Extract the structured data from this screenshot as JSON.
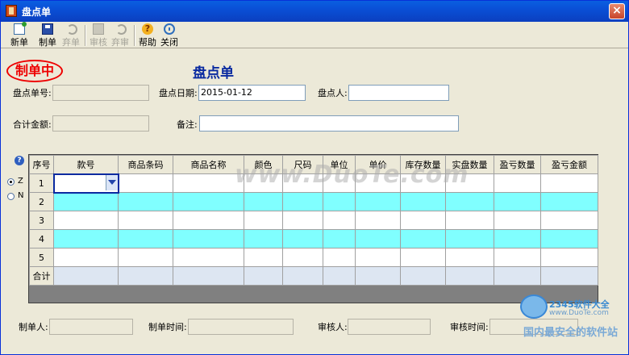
{
  "window": {
    "title": "盘点单",
    "close_symbol": "×"
  },
  "toolbar": {
    "buttons": [
      {
        "label": "新单",
        "icon": "new-document-icon",
        "enabled": true
      },
      {
        "label": "制单",
        "icon": "save-icon",
        "enabled": true
      },
      {
        "label": "弃单",
        "icon": "undo-icon",
        "enabled": false
      },
      {
        "label": "审核",
        "icon": "audit-icon",
        "enabled": false
      },
      {
        "label": "弃审",
        "icon": "undo-icon",
        "enabled": false
      },
      {
        "label": "帮助",
        "icon": "help-icon",
        "enabled": true
      },
      {
        "label": "关闭",
        "icon": "close-circle-icon",
        "enabled": true
      }
    ]
  },
  "status_stamp": "制单中",
  "form": {
    "title": "盘点单",
    "doc_no_label": "盘点单号:",
    "doc_no_value": "",
    "date_label": "盘点日期:",
    "date_value": "2015-01-12",
    "person_label": "盘点人:",
    "person_value": "",
    "total_label": "合计金额:",
    "total_value": "",
    "remark_label": "备注:",
    "remark_value": ""
  },
  "side": {
    "help_symbol": "?",
    "radio_z_label": "Z",
    "radio_n_label": "N",
    "selected": "Z"
  },
  "grid": {
    "columns": [
      "序号",
      "款号",
      "商品条码",
      "商品名称",
      "颜色",
      "尺码",
      "单位",
      "单价",
      "库存数量",
      "实盘数量",
      "盈亏数量",
      "盈亏金额"
    ],
    "rows": [
      "1",
      "2",
      "3",
      "4",
      "5"
    ],
    "total_label": "合计"
  },
  "footer": {
    "maker_label": "制单人:",
    "make_time_label": "制单时间:",
    "auditor_label": "审核人:",
    "audit_time_label": "审核时间:"
  },
  "watermark": {
    "text": "www.DuoTe.com",
    "logo_name": "2345软件大全",
    "logo_url": "www.DuoTe.com",
    "logo_slogan": "国内最安全的软件站"
  },
  "colors": {
    "title_bar": "#0a4fd6",
    "stamp": "#e00000",
    "form_title": "#0a2aa0",
    "row_highlight": "#80ffff"
  }
}
